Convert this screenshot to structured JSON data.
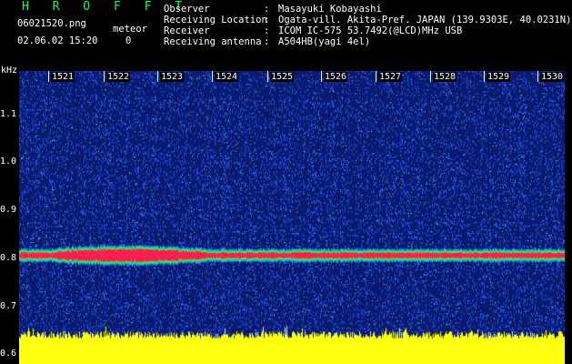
{
  "header": {
    "app_title": "H R O F F T",
    "file_name": "06021520.png",
    "datetime": "02.06.02 15:20",
    "meteor_label": "meteor",
    "meteor_count": "0"
  },
  "info": [
    {
      "label": "Observer",
      "value": "Masayuki Kobayashi"
    },
    {
      "label": "Receiving Location",
      "value": "Ogata-vill. Akita-Pref. JAPAN (139.9303E, 40.0231N)"
    },
    {
      "label": "Receiver",
      "value": "ICOM IC-575 53.7492(@LCD)MHz USB"
    },
    {
      "label": "Receiving antenna",
      "value": "A504HB(yagi 4el)"
    }
  ],
  "colon": ":",
  "y_axis": {
    "unit": "kHz",
    "ticks": [
      {
        "label": "1.1",
        "value": 1.1
      },
      {
        "label": "1.0",
        "value": 1.0
      },
      {
        "label": "0.9",
        "value": 0.9
      },
      {
        "label": "0.8",
        "value": 0.8
      },
      {
        "label": "0.7",
        "value": 0.7
      },
      {
        "label": "0.6",
        "value": 0.6
      }
    ],
    "range": [
      0.58,
      1.19
    ]
  },
  "x_axis": {
    "ticks": [
      "1521",
      "1522",
      "1523",
      "1524",
      "1525",
      "1526",
      "1527",
      "1528",
      "1529",
      "1530"
    ]
  },
  "spectrogram": {
    "signal_freq_khz": 0.806,
    "colors": {
      "bg": "#0a1a6e",
      "noise": "#1d4fe0",
      "speck": "#55c8ff",
      "green": "#22ff55",
      "signal": "#ff1e50",
      "yellow": "#ffff10"
    }
  }
}
